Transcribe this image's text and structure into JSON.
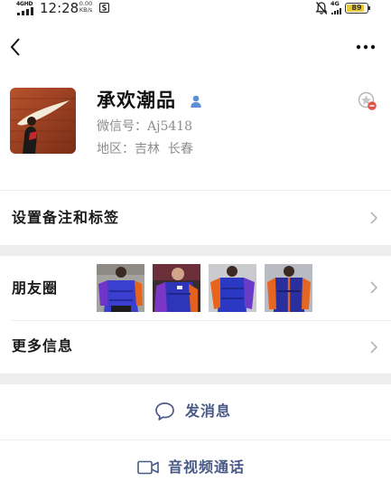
{
  "status_bar": {
    "network_left": "4GHD",
    "time": "12:28",
    "speed_value": "0.00",
    "speed_unit": "KB/s",
    "network_right": "4G",
    "battery": "89",
    "battery_level": 0.89
  },
  "profile": {
    "name": "承欢潮品",
    "wechat_id_label": "微信号：",
    "wechat_id": "Aj5418",
    "region_label": "地区：",
    "region": "吉林  长春"
  },
  "rows": {
    "remark_tags": "设置备注和标签",
    "moments": "朋友圈",
    "more_info": "更多信息"
  },
  "actions": {
    "send_message": "发消息",
    "video_call": "音视频通话"
  },
  "colors": {
    "accent": "#4a5a86",
    "gray_text": "#8d8d8d",
    "separator": "#ededed",
    "gender_blue": "#5d8fd6",
    "battery_yellow": "#e8c93a"
  }
}
